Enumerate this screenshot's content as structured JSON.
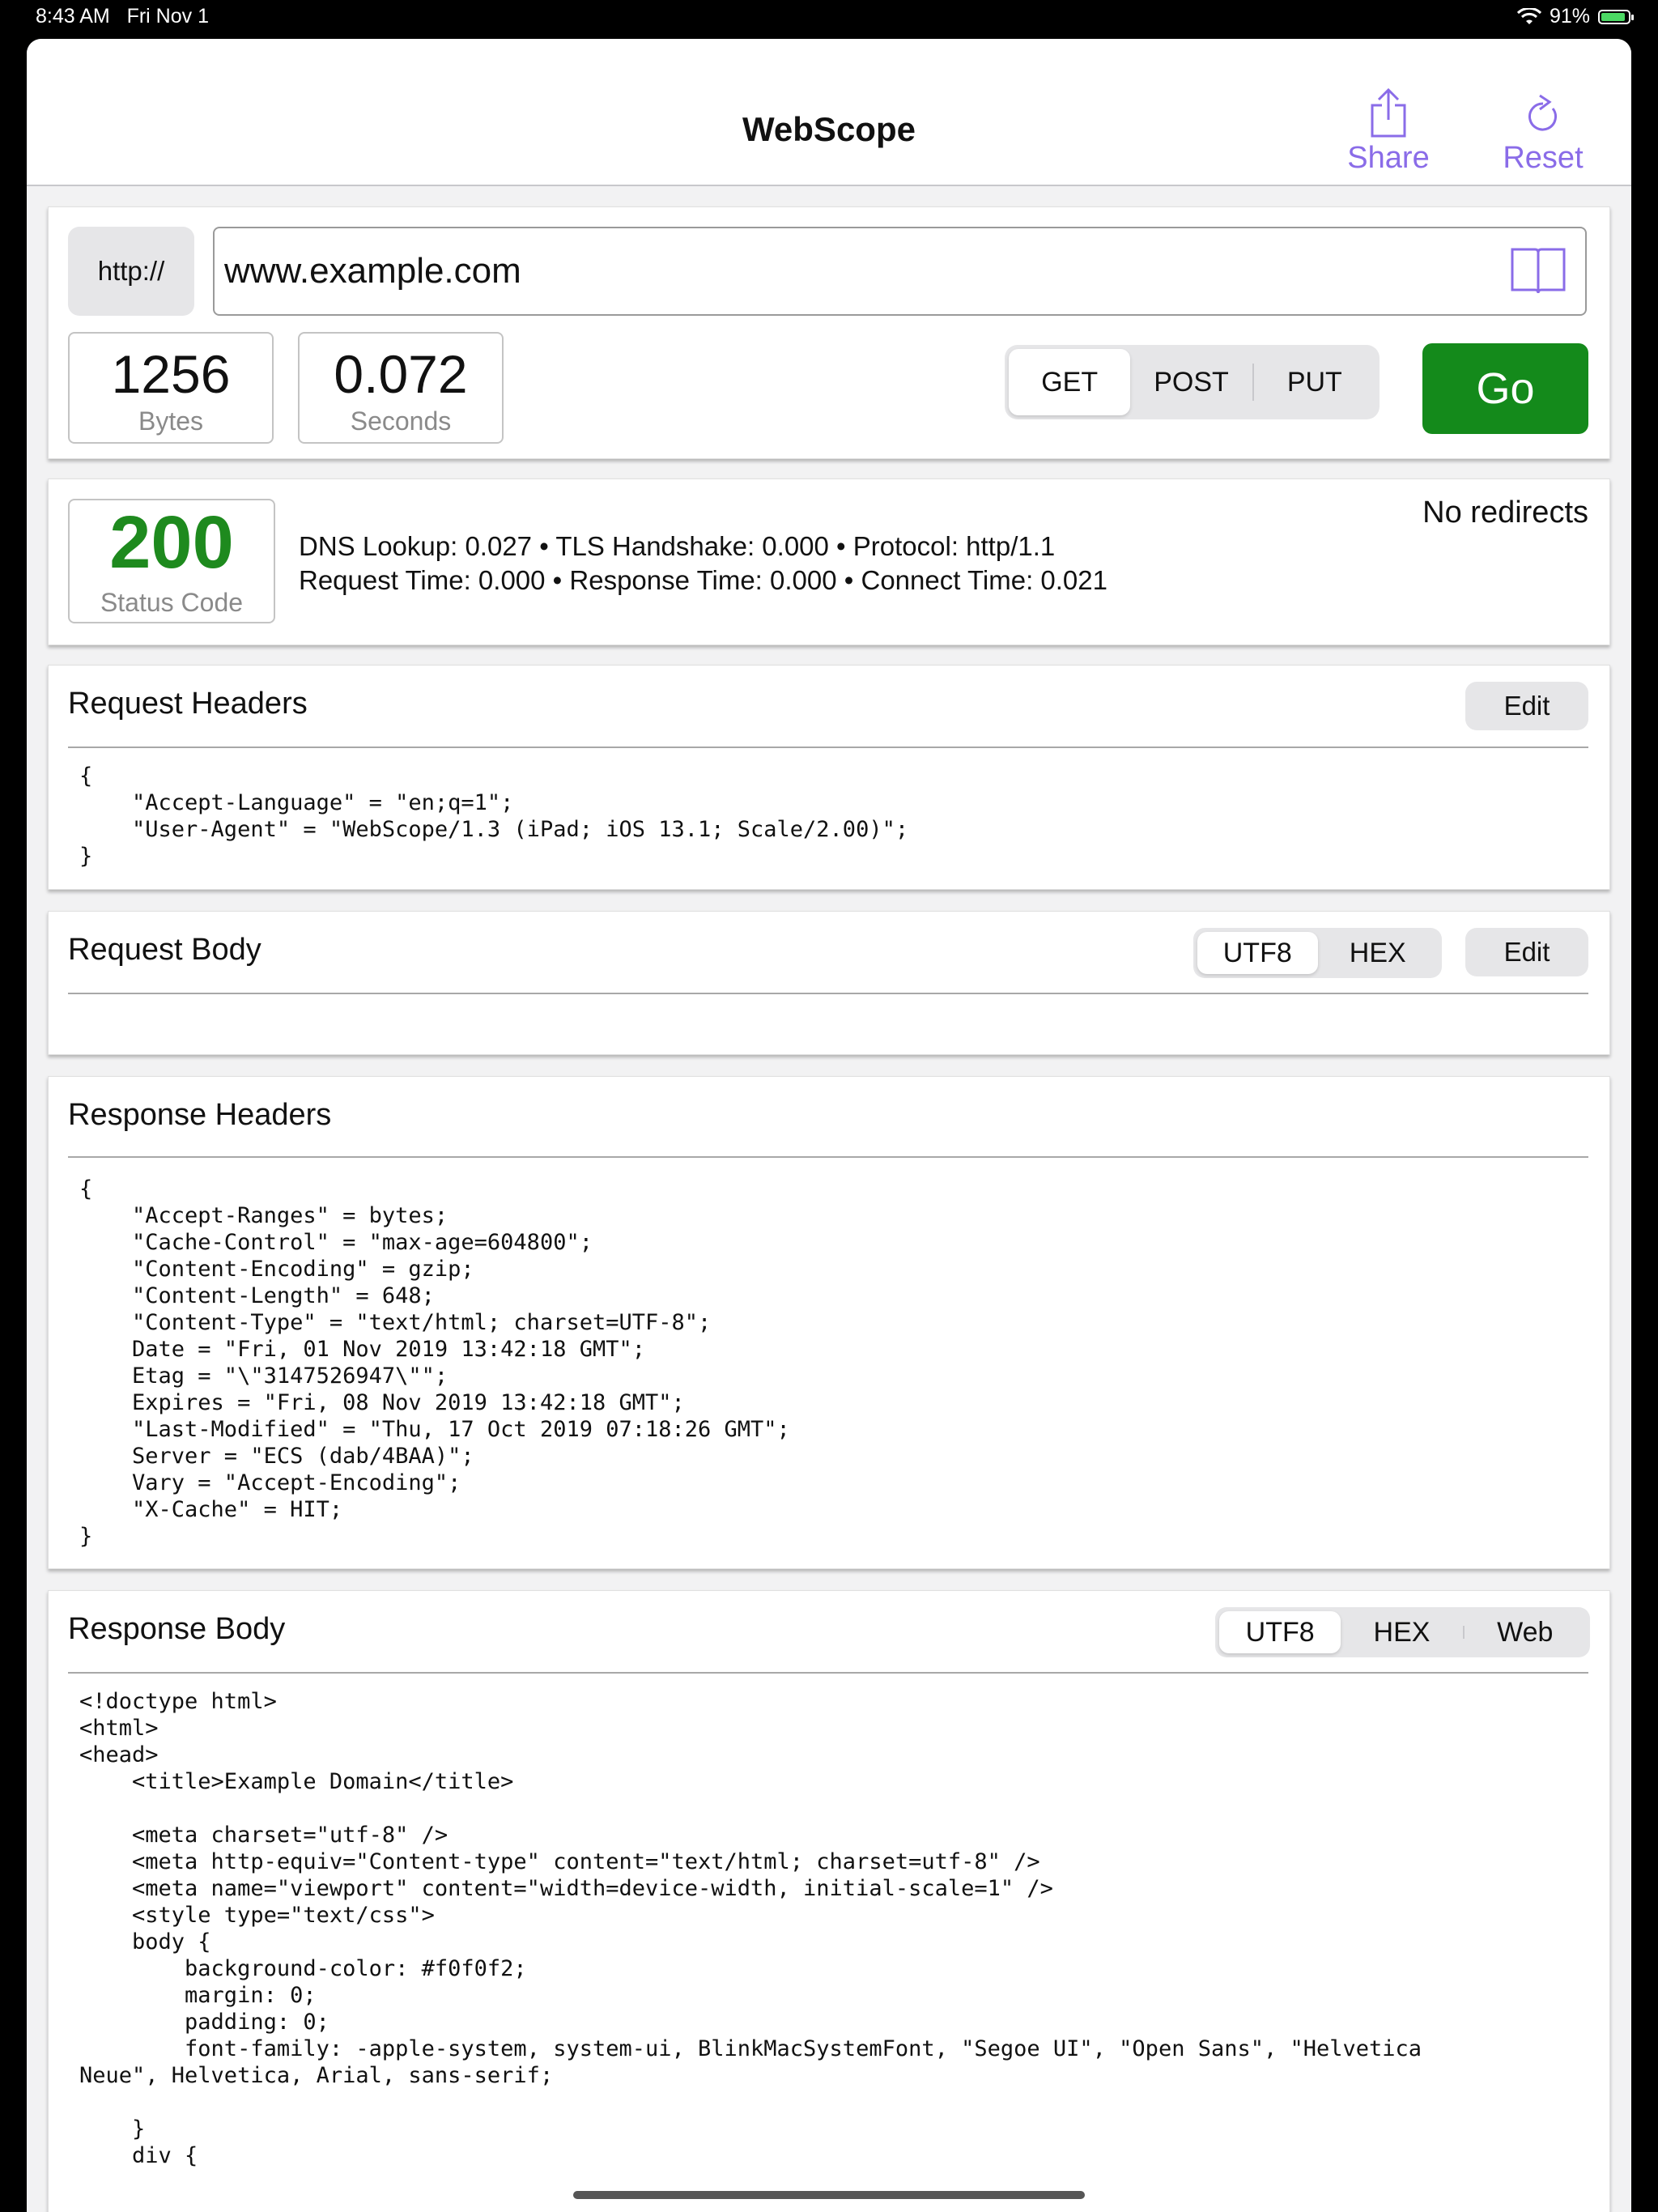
{
  "status_bar": {
    "time": "8:43 AM",
    "date": "Fri Nov 1",
    "battery": "91%",
    "battery_level": 0.91
  },
  "nav": {
    "title": "WebScope",
    "share_label": "Share",
    "reset_label": "Reset"
  },
  "request": {
    "protocol": "http://",
    "url": "www.example.com",
    "bytes_value": "1256",
    "bytes_label": "Bytes",
    "seconds_value": "0.072",
    "seconds_label": "Seconds",
    "methods": [
      "GET",
      "POST",
      "PUT"
    ],
    "selected_method": "GET",
    "go_label": "Go"
  },
  "result": {
    "status_code": "200",
    "status_label": "Status Code",
    "timing_line1": "DNS Lookup: 0.027  •  TLS Handshake: 0.000  •  Protocol: http/1.1",
    "timing_line2": "Request Time: 0.000  •  Response Time: 0.000  •  Connect Time: 0.021",
    "redirects": "No redirects"
  },
  "request_headers": {
    "title": "Request Headers",
    "edit_label": "Edit",
    "content": "{\n    \"Accept-Language\" = \"en;q=1\";\n    \"User-Agent\" = \"WebScope/1.3 (iPad; iOS 13.1; Scale/2.00)\";\n}"
  },
  "request_body": {
    "title": "Request Body",
    "encodings": [
      "UTF8",
      "HEX"
    ],
    "selected_encoding": "UTF8",
    "edit_label": "Edit"
  },
  "response_headers": {
    "title": "Response Headers",
    "content": "{\n    \"Accept-Ranges\" = bytes;\n    \"Cache-Control\" = \"max-age=604800\";\n    \"Content-Encoding\" = gzip;\n    \"Content-Length\" = 648;\n    \"Content-Type\" = \"text/html; charset=UTF-8\";\n    Date = \"Fri, 01 Nov 2019 13:42:18 GMT\";\n    Etag = \"\\\"3147526947\\\"\";\n    Expires = \"Fri, 08 Nov 2019 13:42:18 GMT\";\n    \"Last-Modified\" = \"Thu, 17 Oct 2019 07:18:26 GMT\";\n    Server = \"ECS (dab/4BAA)\";\n    Vary = \"Accept-Encoding\";\n    \"X-Cache\" = HIT;\n}"
  },
  "response_body": {
    "title": "Response Body",
    "modes": [
      "UTF8",
      "HEX",
      "Web"
    ],
    "selected_mode": "UTF8",
    "content": "<!doctype html>\n<html>\n<head>\n    <title>Example Domain</title>\n\n    <meta charset=\"utf-8\" />\n    <meta http-equiv=\"Content-type\" content=\"text/html; charset=utf-8\" />\n    <meta name=\"viewport\" content=\"width=device-width, initial-scale=1\" />\n    <style type=\"text/css\">\n    body {\n        background-color: #f0f0f2;\n        margin: 0;\n        padding: 0;\n        font-family: -apple-system, system-ui, BlinkMacSystemFont, \"Segoe UI\", \"Open Sans\", \"Helvetica\nNeue\", Helvetica, Arial, sans-serif;\n\n    }\n    div {"
  },
  "colors": {
    "accent": "#8a6ce8",
    "go_green": "#148a1b",
    "status_green": "#1e8a1e"
  }
}
